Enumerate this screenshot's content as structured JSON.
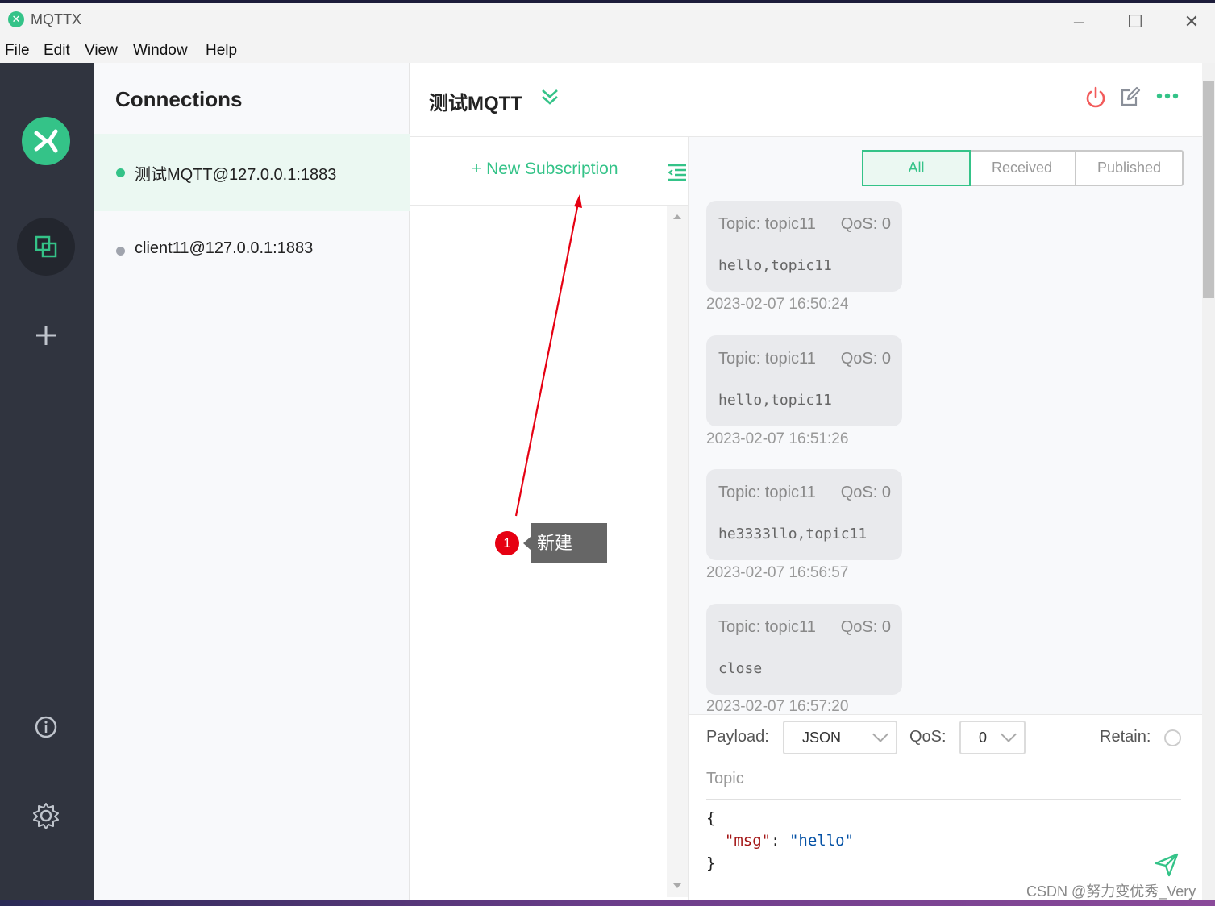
{
  "window": {
    "title": "MQTTX",
    "logo_glyph": "✕",
    "minimize": "–",
    "maximize": "☐",
    "close": "✕"
  },
  "menu": [
    "File",
    "Edit",
    "View",
    "Window",
    "Help"
  ],
  "connections": {
    "title": "Connections",
    "items": [
      {
        "name": "测试MQTT@127.0.0.1:1883",
        "status_color": "#34c388"
      },
      {
        "name": "client11@127.0.0.1:1883",
        "status_color": "#a0a4ad"
      }
    ]
  },
  "header": {
    "connection_title": "测试MQTT"
  },
  "subscriptions": {
    "new_label": "+ New Subscription"
  },
  "filter": [
    "All",
    "Received",
    "Published"
  ],
  "messages": [
    {
      "topic": "Topic: topic11",
      "qos": "QoS: 0",
      "payload": "hello,topic11",
      "time": "2023-02-07 16:50:24"
    },
    {
      "topic": "Topic: topic11",
      "qos": "QoS: 0",
      "payload": "hello,topic11",
      "time": "2023-02-07 16:51:26"
    },
    {
      "topic": "Topic: topic11",
      "qos": "QoS: 0",
      "payload": "he3333llo,topic11",
      "time": "2023-02-07 16:56:57"
    },
    {
      "topic": "Topic: topic11",
      "qos": "QoS: 0",
      "payload": "close",
      "time": "2023-02-07 16:57:20"
    }
  ],
  "composer": {
    "payload_label": "Payload:",
    "payload_format": "JSON",
    "qos_label": "QoS:",
    "qos_value": "0",
    "retain_label": "Retain:",
    "topic_placeholder": "Topic",
    "code_open": "{",
    "code_key": "\"msg\"",
    "code_colon": ": ",
    "code_value": "\"hello\"",
    "code_close": "}"
  },
  "annotation": {
    "number": "1",
    "text": "新建"
  },
  "watermark": "CSDN @努力变优秀_Very",
  "colors": {
    "accent": "#34c388",
    "sidebar": "#30343f",
    "disconnect": "#f25b5b",
    "annotation": "#e60012"
  }
}
